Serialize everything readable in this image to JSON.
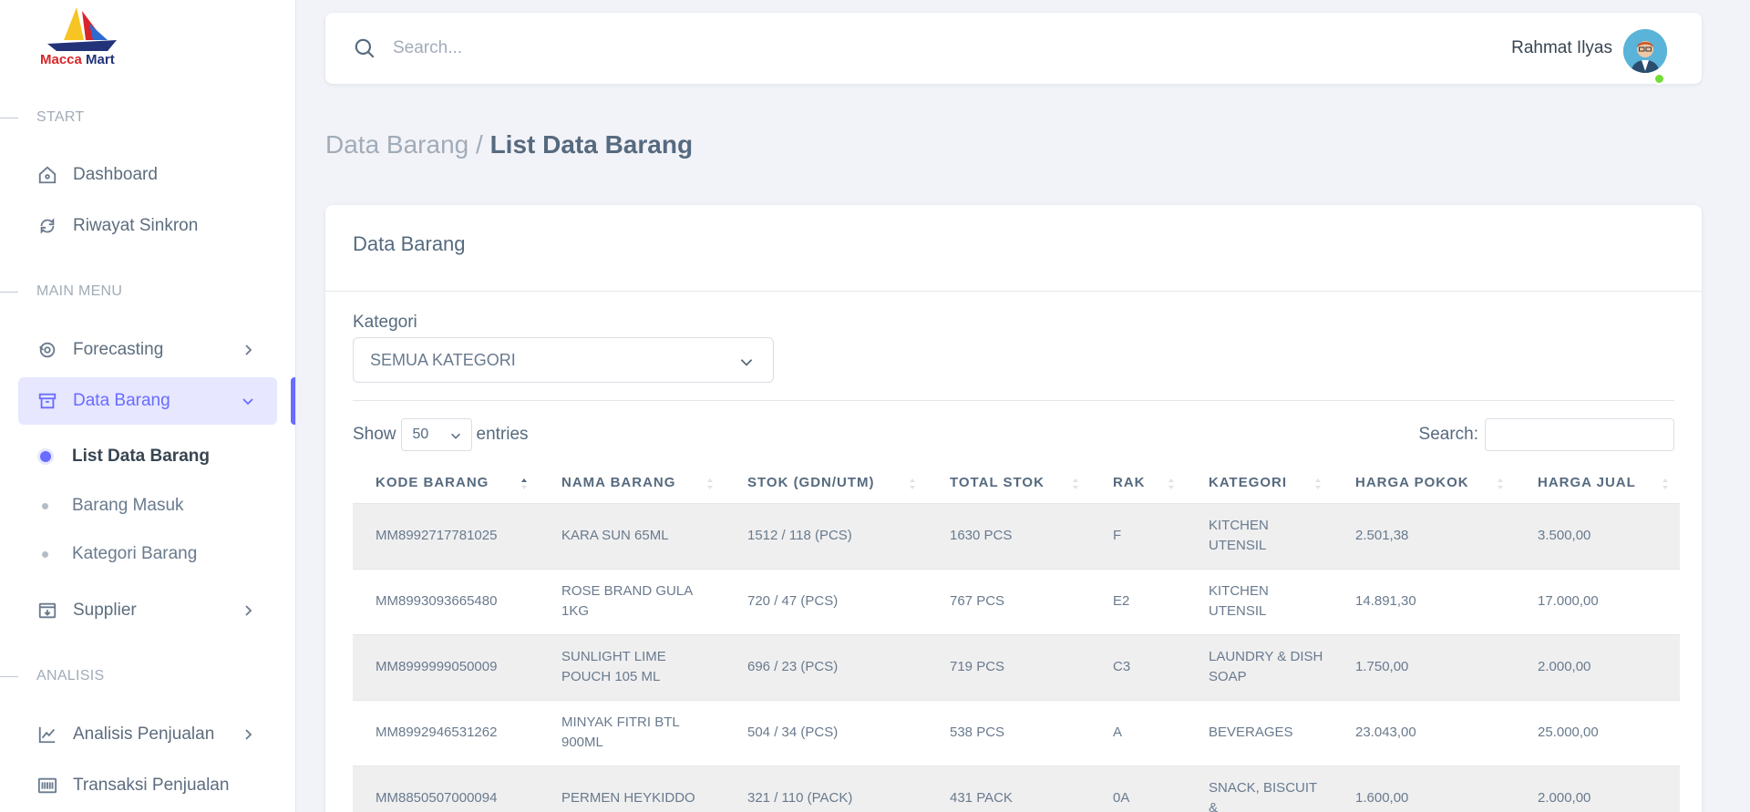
{
  "brand": {
    "name_part1": "Macca",
    "name_part2": "Mart"
  },
  "sidebar": {
    "sections": {
      "start": "START",
      "main_menu": "MAIN MENU",
      "analisis": "ANALISIS"
    },
    "items": {
      "dashboard": "Dashboard",
      "riwayat": "Riwayat Sinkron",
      "forecasting": "Forecasting",
      "data_barang": "Data Barang",
      "supplier": "Supplier",
      "analisis_penjualan": "Analisis Penjualan",
      "transaksi": "Transaksi Penjualan"
    },
    "subitems": {
      "list": "List Data Barang",
      "masuk": "Barang Masuk",
      "kategori": "Kategori Barang"
    }
  },
  "topbar": {
    "search_placeholder": "Search...",
    "user_name": "Rahmat Ilyas"
  },
  "breadcrumb": {
    "parent": "Data Barang /",
    "current": "List Data Barang"
  },
  "card": {
    "title": "Data Barang",
    "kategori_label": "Kategori",
    "kategori_value": "SEMUA KATEGORI",
    "show_label": "Show",
    "entries_value": "50",
    "entries_label": "entries",
    "search_label": "Search:"
  },
  "table": {
    "columns": [
      "KODE BARANG",
      "NAMA BARANG",
      "STOK (GDN/UTM)",
      "TOTAL STOK",
      "RAK",
      "KATEGORI",
      "HARGA POKOK",
      "HARGA JUAL"
    ],
    "rows": [
      [
        "MM8992717781025",
        "KARA SUN 65ML",
        "1512 / 118 (PCS)",
        "1630 PCS",
        "F",
        "KITCHEN UTENSIL",
        "2.501,38",
        "3.500,00"
      ],
      [
        "MM8993093665480",
        "ROSE BRAND GULA 1KG",
        "720 / 47 (PCS)",
        "767 PCS",
        "E2",
        "KITCHEN UTENSIL",
        "14.891,30",
        "17.000,00"
      ],
      [
        "MM8999999050009",
        "SUNLIGHT LIME POUCH 105 ML",
        "696 / 23 (PCS)",
        "719 PCS",
        "C3",
        "LAUNDRY & DISH SOAP",
        "1.750,00",
        "2.000,00"
      ],
      [
        "MM8992946531262",
        "MINYAK FITRI BTL 900ML",
        "504 / 34 (PCS)",
        "538 PCS",
        "A",
        "BEVERAGES",
        "23.043,00",
        "25.000,00"
      ],
      [
        "MM8850507000094",
        "PERMEN HEYKIDDO",
        "321 / 110 (PACK)",
        "431 PACK",
        "0A",
        "SNACK, BISCUIT &",
        "1.600,00",
        "2.000,00"
      ]
    ]
  }
}
